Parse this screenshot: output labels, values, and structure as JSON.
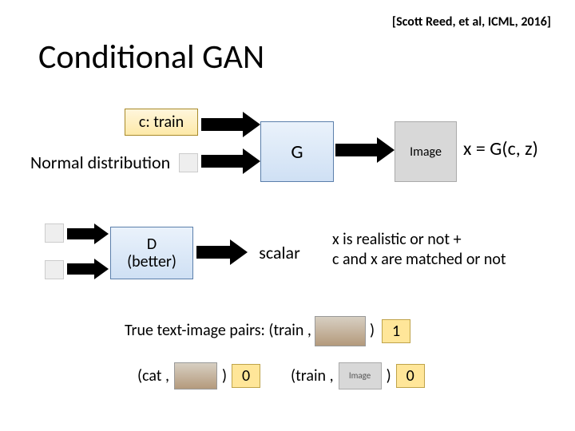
{
  "citation": "[Scott Reed, et al, ICML, 2016]",
  "title": "Conditional GAN",
  "c_label": "c: train",
  "g_label": "G",
  "image_label": "Image",
  "equation": "x = G(c, z)",
  "normal_dist": "Normal distribution",
  "d_line1": "D",
  "d_line2": "(better)",
  "scalar": "scalar",
  "desc_line1": "x is realistic or not +",
  "desc_line2": "c and x are matched or not",
  "pairs_label_prefix": "True text-image pairs:  (train ,",
  "pairs_label_suffix": ")",
  "score_1": "1",
  "cat_pair": "(cat ,",
  "train_pair": "(train ,",
  "close_paren": ")",
  "score_0a": "0",
  "score_0b": "0",
  "img_placeholder": "Image"
}
